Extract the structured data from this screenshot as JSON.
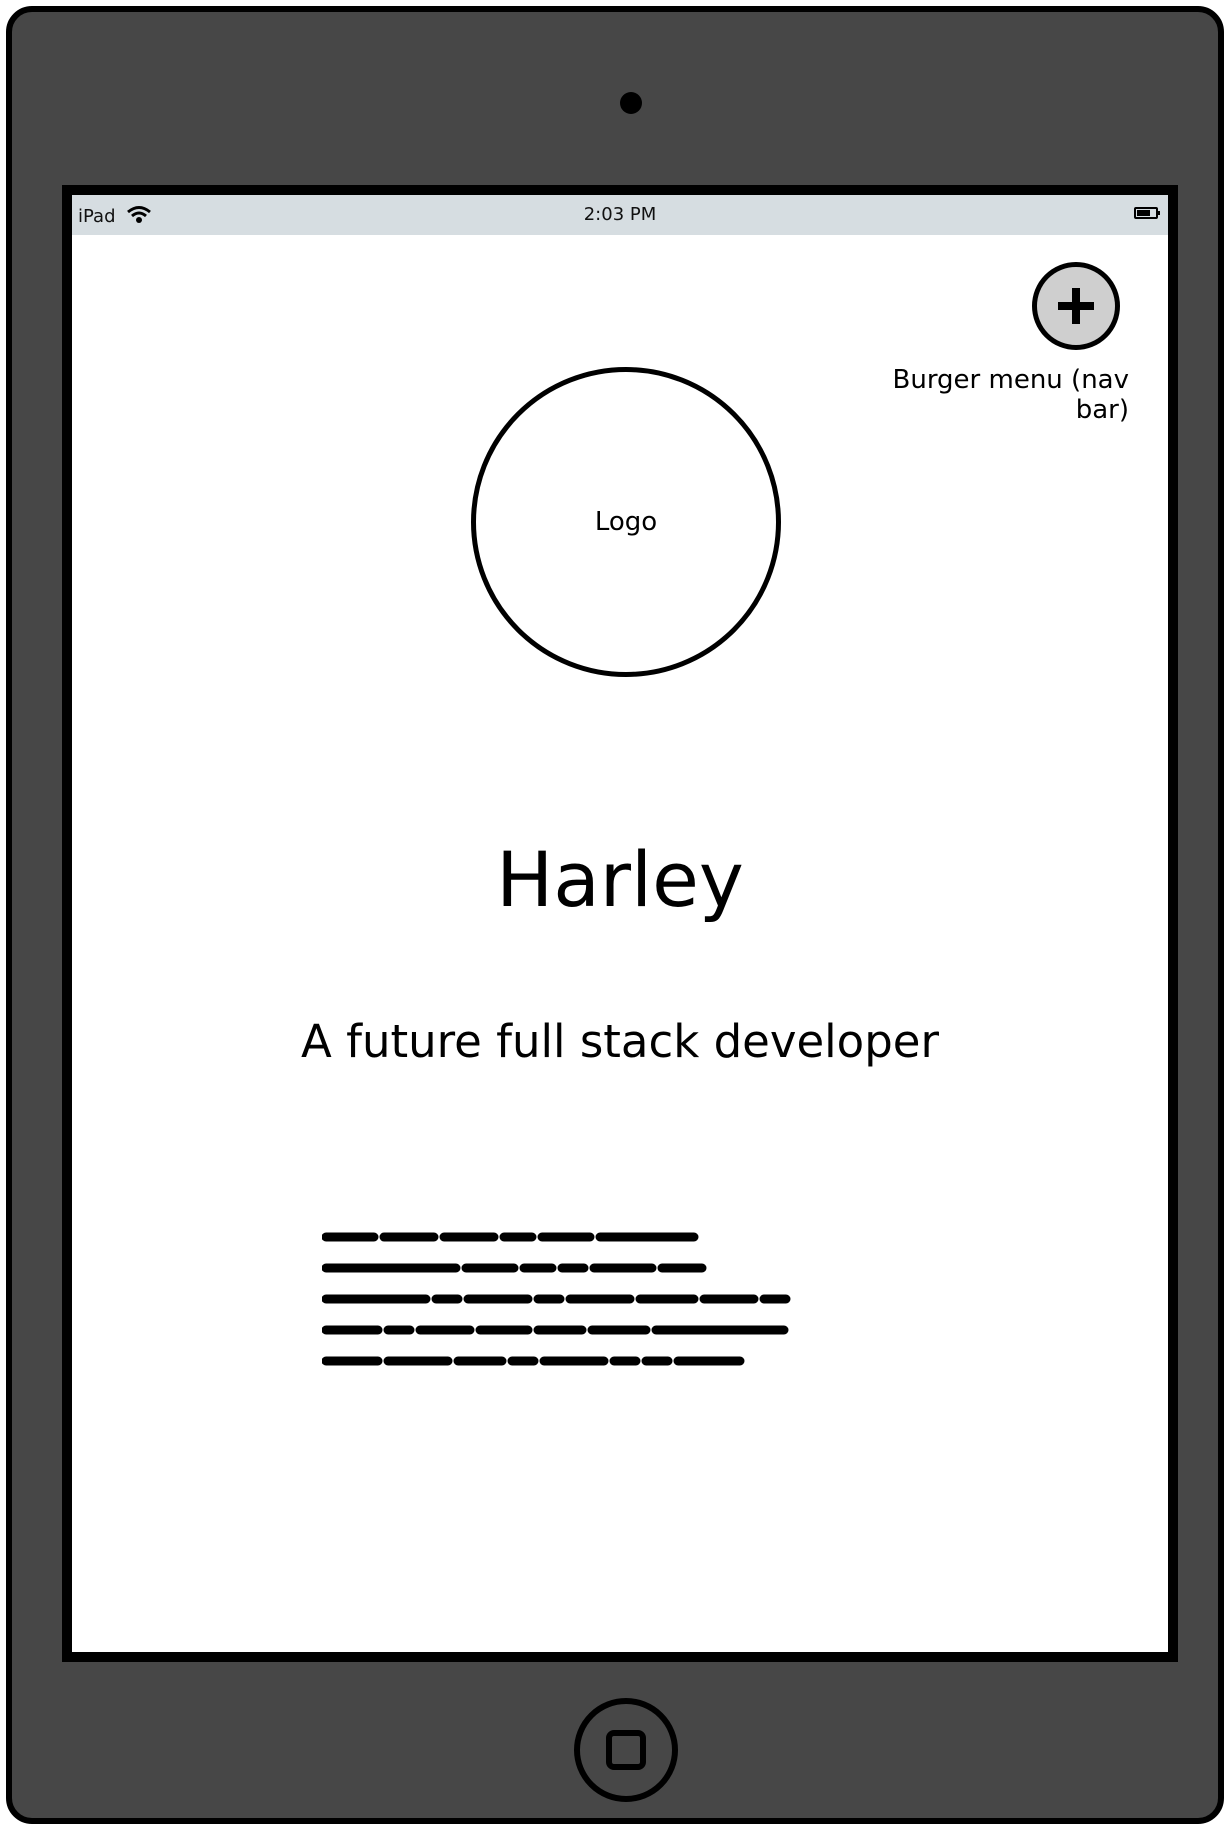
{
  "statusbar": {
    "device": "iPad",
    "time": "2:03 PM"
  },
  "nav": {
    "button_icon": "plus-icon",
    "label": "Burger menu (nav bar)"
  },
  "logo": {
    "label": "Logo"
  },
  "hero": {
    "title": "Harley",
    "subtitle": "A future full stack developer"
  },
  "colors": {
    "device_frame": "#474747",
    "status_bar": "#d6dde1",
    "button_fill": "#cfcfcf",
    "ink": "#000000"
  }
}
